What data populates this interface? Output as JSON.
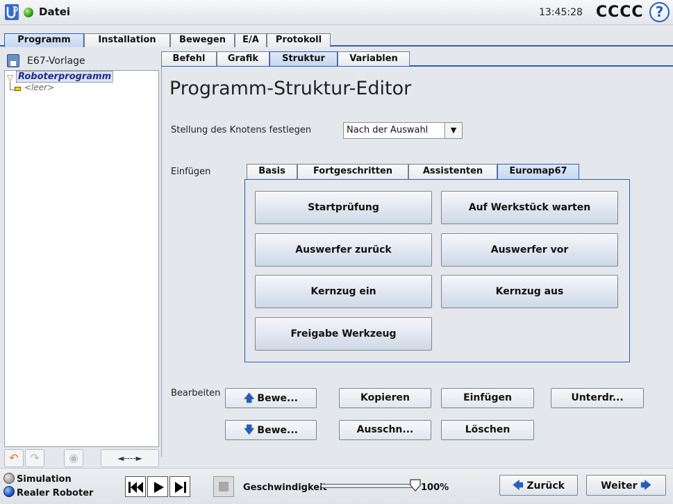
{
  "titlebar": {
    "app_name": "Datei",
    "clock": "13:45:28",
    "robot_name": "CCCC",
    "help_glyph": "?"
  },
  "main_tabs": [
    {
      "label": "Programm",
      "active": true
    },
    {
      "label": "Installation",
      "active": false
    },
    {
      "label": "Bewegen",
      "active": false
    },
    {
      "label": "E/A",
      "active": false
    },
    {
      "label": "Protokoll",
      "active": false
    }
  ],
  "tree": {
    "file_name": "E67-Vorlage",
    "root_label": "Roboterprogramm",
    "child_label": "<leer>",
    "toolbar_icons": [
      "undo-icon",
      "redo-icon",
      "record-icon",
      "slider-arrows-icon"
    ],
    "slider_glyph": "◄----►"
  },
  "sub_tabs": [
    {
      "label": "Befehl",
      "active": false
    },
    {
      "label": "Grafik",
      "active": false
    },
    {
      "label": "Struktur",
      "active": true
    },
    {
      "label": "Variablen",
      "active": false
    }
  ],
  "editor": {
    "title": "Programm-Struktur-Editor",
    "position_label": "Stellung des Knotens festlegen",
    "position_value": "Nach der Auswahl",
    "insert_label": "Einfügen",
    "insert_tabs": [
      {
        "label": "Basis",
        "active": false
      },
      {
        "label": "Fortgeschritten",
        "active": false
      },
      {
        "label": "Assistenten",
        "active": false
      },
      {
        "label": "Euromap67",
        "active": true
      }
    ],
    "euromap_buttons": [
      "Startprüfung",
      "Auf Werkstück warten",
      "Auswerfer zurück",
      "Auswerfer vor",
      "Kernzug ein",
      "Kernzug aus",
      "Freigabe Werkzeug"
    ],
    "edit_label": "Bearbeiten",
    "edit_buttons": {
      "move_up": "Bewe...",
      "copy": "Kopieren",
      "paste": "Einfügen",
      "suppress": "Unterdr...",
      "move_down": "Bewe...",
      "cut": "Ausschn...",
      "delete": "Löschen"
    }
  },
  "bottom": {
    "simulation_label": "Simulation",
    "real_robot_label": "Realer Roboter",
    "mode_selected": "Realer Roboter",
    "speed_label": "Geschwindigkeit",
    "speed_value": "100%",
    "speed_fraction": 1.0,
    "back_label": "Zurück",
    "next_label": "Weiter"
  },
  "colors": {
    "accent": "#2a5db8",
    "status_ok": "#2e9a1a"
  }
}
